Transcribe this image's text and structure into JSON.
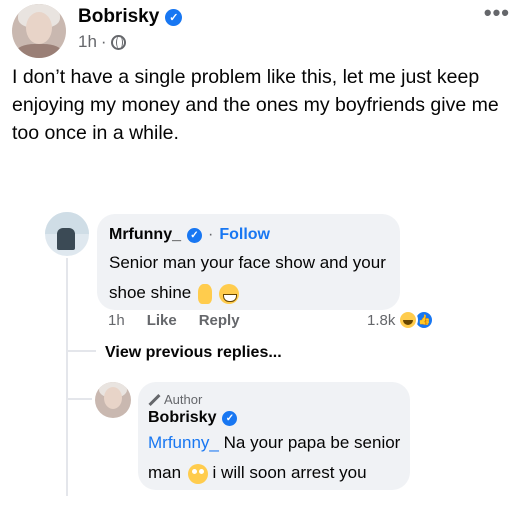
{
  "post": {
    "author": "Bobrisky",
    "verified_mark": "✓",
    "time": "1h",
    "separator": "·",
    "more_label": "•••",
    "text": "I don’t have a single problem like this, let me just keep enjoying my money and the ones my boyfriends give me too once in a while."
  },
  "comment1": {
    "author": "Mrfunny_",
    "separator": "·",
    "follow_label": "Follow",
    "text": "Senior man your face show and your shoe shine",
    "time": "1h",
    "like_label": "Like",
    "reply_label": "Reply",
    "reaction_count": "1.8k",
    "reactions": [
      "haha-icon",
      "like-icon"
    ]
  },
  "view_previous_label": "View previous replies...",
  "reply1": {
    "badge": "Author",
    "author": "Bobrisky",
    "mention": "Mrfunny_",
    "text_before_emoji": "Na your papa be senior man",
    "text_after_emoji": "i will soon arrest you"
  },
  "colors": {
    "accent": "#1877f2",
    "bubble": "#f0f2f5",
    "secondary_text": "#65676b"
  }
}
